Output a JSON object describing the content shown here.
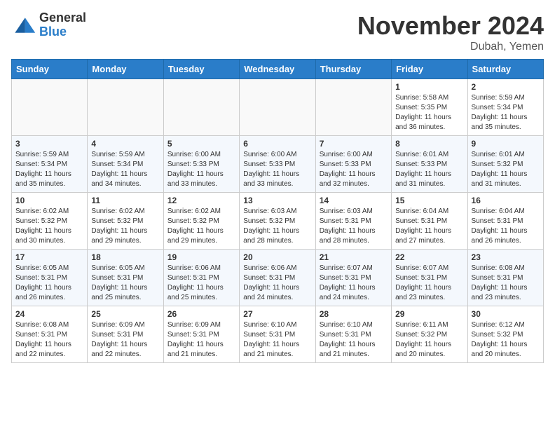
{
  "logo": {
    "general": "General",
    "blue": "Blue"
  },
  "title": "November 2024",
  "location": "Dubah, Yemen",
  "weekdays": [
    "Sunday",
    "Monday",
    "Tuesday",
    "Wednesday",
    "Thursday",
    "Friday",
    "Saturday"
  ],
  "weeks": [
    [
      {
        "day": "",
        "info": ""
      },
      {
        "day": "",
        "info": ""
      },
      {
        "day": "",
        "info": ""
      },
      {
        "day": "",
        "info": ""
      },
      {
        "day": "",
        "info": ""
      },
      {
        "day": "1",
        "info": "Sunrise: 5:58 AM\nSunset: 5:35 PM\nDaylight: 11 hours\nand 36 minutes."
      },
      {
        "day": "2",
        "info": "Sunrise: 5:59 AM\nSunset: 5:34 PM\nDaylight: 11 hours\nand 35 minutes."
      }
    ],
    [
      {
        "day": "3",
        "info": "Sunrise: 5:59 AM\nSunset: 5:34 PM\nDaylight: 11 hours\nand 35 minutes."
      },
      {
        "day": "4",
        "info": "Sunrise: 5:59 AM\nSunset: 5:34 PM\nDaylight: 11 hours\nand 34 minutes."
      },
      {
        "day": "5",
        "info": "Sunrise: 6:00 AM\nSunset: 5:33 PM\nDaylight: 11 hours\nand 33 minutes."
      },
      {
        "day": "6",
        "info": "Sunrise: 6:00 AM\nSunset: 5:33 PM\nDaylight: 11 hours\nand 33 minutes."
      },
      {
        "day": "7",
        "info": "Sunrise: 6:00 AM\nSunset: 5:33 PM\nDaylight: 11 hours\nand 32 minutes."
      },
      {
        "day": "8",
        "info": "Sunrise: 6:01 AM\nSunset: 5:33 PM\nDaylight: 11 hours\nand 31 minutes."
      },
      {
        "day": "9",
        "info": "Sunrise: 6:01 AM\nSunset: 5:32 PM\nDaylight: 11 hours\nand 31 minutes."
      }
    ],
    [
      {
        "day": "10",
        "info": "Sunrise: 6:02 AM\nSunset: 5:32 PM\nDaylight: 11 hours\nand 30 minutes."
      },
      {
        "day": "11",
        "info": "Sunrise: 6:02 AM\nSunset: 5:32 PM\nDaylight: 11 hours\nand 29 minutes."
      },
      {
        "day": "12",
        "info": "Sunrise: 6:02 AM\nSunset: 5:32 PM\nDaylight: 11 hours\nand 29 minutes."
      },
      {
        "day": "13",
        "info": "Sunrise: 6:03 AM\nSunset: 5:32 PM\nDaylight: 11 hours\nand 28 minutes."
      },
      {
        "day": "14",
        "info": "Sunrise: 6:03 AM\nSunset: 5:31 PM\nDaylight: 11 hours\nand 28 minutes."
      },
      {
        "day": "15",
        "info": "Sunrise: 6:04 AM\nSunset: 5:31 PM\nDaylight: 11 hours\nand 27 minutes."
      },
      {
        "day": "16",
        "info": "Sunrise: 6:04 AM\nSunset: 5:31 PM\nDaylight: 11 hours\nand 26 minutes."
      }
    ],
    [
      {
        "day": "17",
        "info": "Sunrise: 6:05 AM\nSunset: 5:31 PM\nDaylight: 11 hours\nand 26 minutes."
      },
      {
        "day": "18",
        "info": "Sunrise: 6:05 AM\nSunset: 5:31 PM\nDaylight: 11 hours\nand 25 minutes."
      },
      {
        "day": "19",
        "info": "Sunrise: 6:06 AM\nSunset: 5:31 PM\nDaylight: 11 hours\nand 25 minutes."
      },
      {
        "day": "20",
        "info": "Sunrise: 6:06 AM\nSunset: 5:31 PM\nDaylight: 11 hours\nand 24 minutes."
      },
      {
        "day": "21",
        "info": "Sunrise: 6:07 AM\nSunset: 5:31 PM\nDaylight: 11 hours\nand 24 minutes."
      },
      {
        "day": "22",
        "info": "Sunrise: 6:07 AM\nSunset: 5:31 PM\nDaylight: 11 hours\nand 23 minutes."
      },
      {
        "day": "23",
        "info": "Sunrise: 6:08 AM\nSunset: 5:31 PM\nDaylight: 11 hours\nand 23 minutes."
      }
    ],
    [
      {
        "day": "24",
        "info": "Sunrise: 6:08 AM\nSunset: 5:31 PM\nDaylight: 11 hours\nand 22 minutes."
      },
      {
        "day": "25",
        "info": "Sunrise: 6:09 AM\nSunset: 5:31 PM\nDaylight: 11 hours\nand 22 minutes."
      },
      {
        "day": "26",
        "info": "Sunrise: 6:09 AM\nSunset: 5:31 PM\nDaylight: 11 hours\nand 21 minutes."
      },
      {
        "day": "27",
        "info": "Sunrise: 6:10 AM\nSunset: 5:31 PM\nDaylight: 11 hours\nand 21 minutes."
      },
      {
        "day": "28",
        "info": "Sunrise: 6:10 AM\nSunset: 5:31 PM\nDaylight: 11 hours\nand 21 minutes."
      },
      {
        "day": "29",
        "info": "Sunrise: 6:11 AM\nSunset: 5:32 PM\nDaylight: 11 hours\nand 20 minutes."
      },
      {
        "day": "30",
        "info": "Sunrise: 6:12 AM\nSunset: 5:32 PM\nDaylight: 11 hours\nand 20 minutes."
      }
    ]
  ]
}
